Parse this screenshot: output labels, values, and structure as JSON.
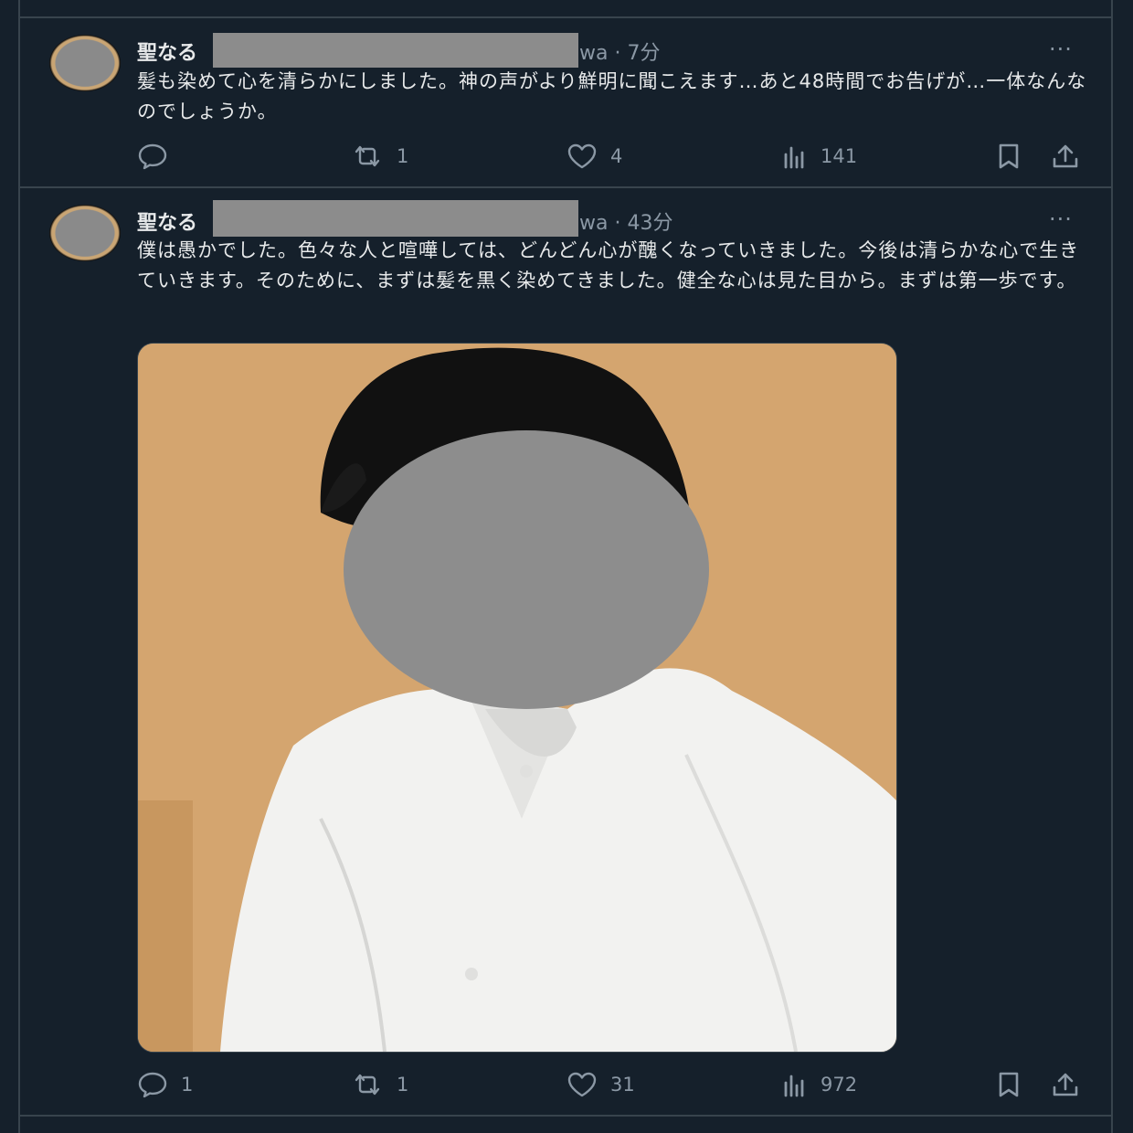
{
  "tweets": [
    {
      "handle": "聖なる",
      "meta": "wa · 7分",
      "text": "髪も染めて心を清らかにしました。神の声がより鮮明に聞こえます…あと48時間でお告げが…一体なんなのでしょうか。",
      "replies": "",
      "retweets": "1",
      "likes": "4",
      "views": "141"
    },
    {
      "handle": "聖なる",
      "meta": "wa · 43分",
      "text": "僕は愚かでした。色々な人と喧嘩しては、どんどん心が醜くなっていきました。今後は清らかな心で生きていきます。そのために、まずは髪を黒く染めてきました。健全な心は見た目から。まずは第一歩です。",
      "replies": "1",
      "retweets": "1",
      "likes": "31",
      "views": "972"
    }
  ],
  "more_label": "···",
  "colors": {
    "background": "#15202b",
    "divider": "#38444d",
    "text": "#e7e9ea",
    "muted": "#8b98a5"
  }
}
